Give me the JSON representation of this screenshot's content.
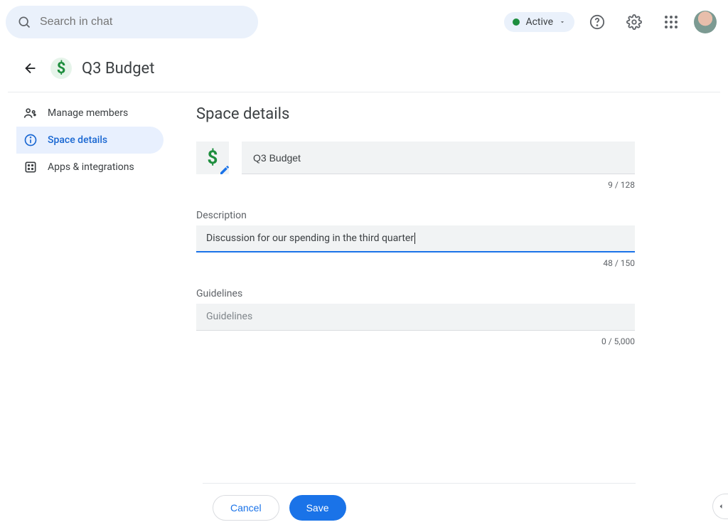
{
  "search": {
    "placeholder": "Search in chat"
  },
  "status": {
    "label": "Active"
  },
  "header": {
    "space_name": "Q3 Budget"
  },
  "sidebar": {
    "items": [
      {
        "label": "Manage members"
      },
      {
        "label": "Space details"
      },
      {
        "label": "Apps & integrations"
      }
    ]
  },
  "main": {
    "heading": "Space details",
    "name_value": "Q3 Budget",
    "name_counter": "9 / 128",
    "description_label": "Description",
    "description_value": "Discussion for our spending in the third quarter",
    "description_counter": "48 / 150",
    "guidelines_label": "Guidelines",
    "guidelines_placeholder": "Guidelines",
    "guidelines_counter": "0 / 5,000"
  },
  "footer": {
    "cancel": "Cancel",
    "save": "Save"
  }
}
